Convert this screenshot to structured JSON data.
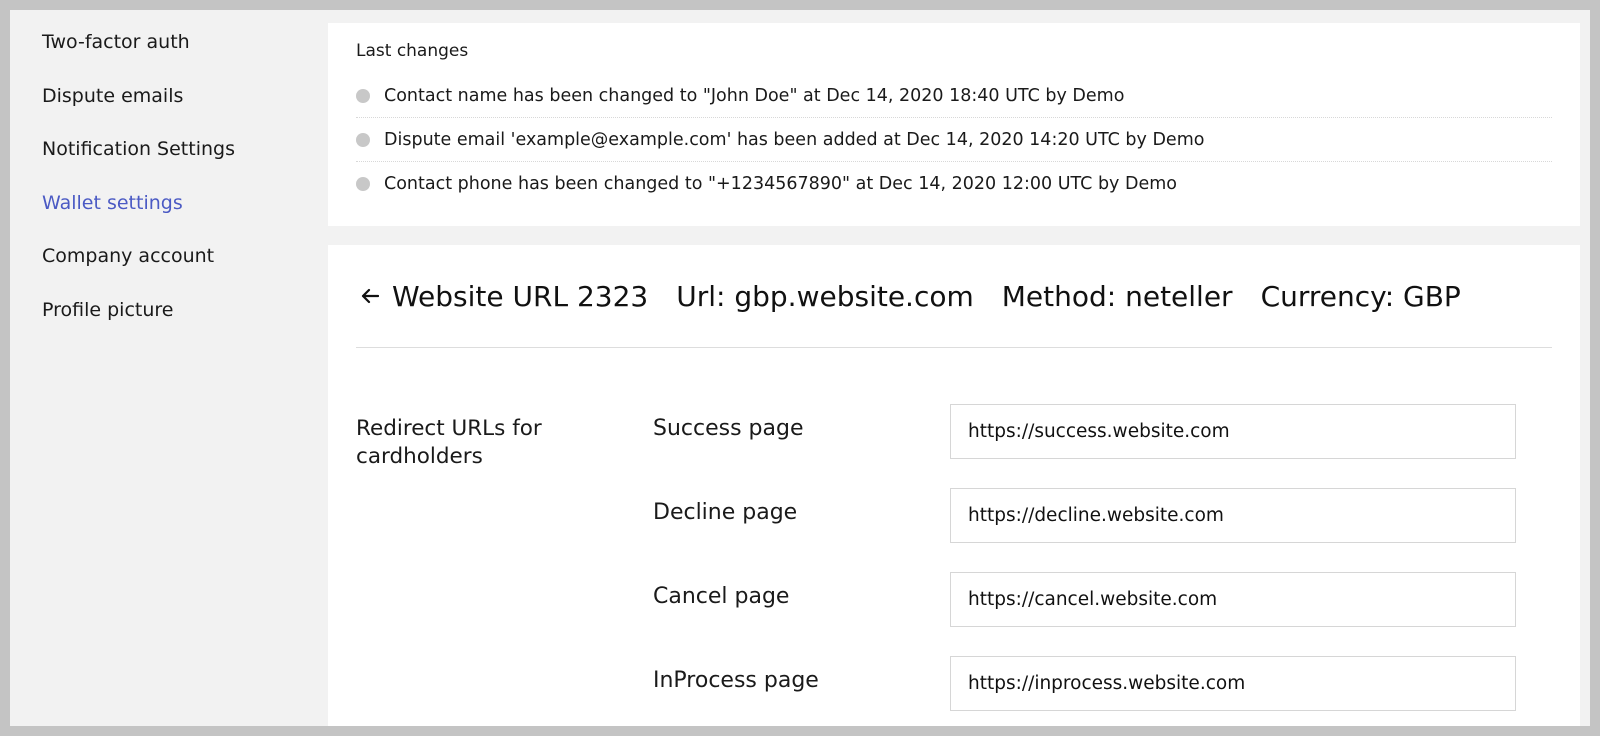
{
  "sidebar": {
    "items": [
      {
        "label": "Two-factor auth",
        "active": false
      },
      {
        "label": "Dispute emails",
        "active": false
      },
      {
        "label": "Notification Settings",
        "active": false
      },
      {
        "label": "Wallet settings",
        "active": true
      },
      {
        "label": "Company account",
        "active": false
      },
      {
        "label": "Profile picture",
        "active": false
      }
    ],
    "active_color": "#4b5ac4"
  },
  "last_changes": {
    "title": "Last changes",
    "items": [
      "Contact name has been changed to \"John Doe\" at Dec 14, 2020 18:40 UTC by Demo",
      "Dispute email 'example@example.com' has been added at Dec 14, 2020 14:20 UTC by Demo",
      "Contact phone has been changed to \"+1234567890\" at Dec 14, 2020 12:00 UTC by Demo"
    ]
  },
  "wallet": {
    "back_icon": "arrow-left-icon",
    "name": "Website URL 2323",
    "url": "Url: gbp.website.com",
    "method": "Method: neteller",
    "currency": "Currency: GBP",
    "redirects_label": "Redirect URLs for cardholders",
    "redirects": [
      {
        "label": "Success page",
        "value": "https://success.website.com"
      },
      {
        "label": "Decline page",
        "value": "https://decline.website.com"
      },
      {
        "label": "Cancel page",
        "value": "https://cancel.website.com"
      },
      {
        "label": "InProcess page",
        "value": "https://inprocess.website.com"
      }
    ]
  }
}
